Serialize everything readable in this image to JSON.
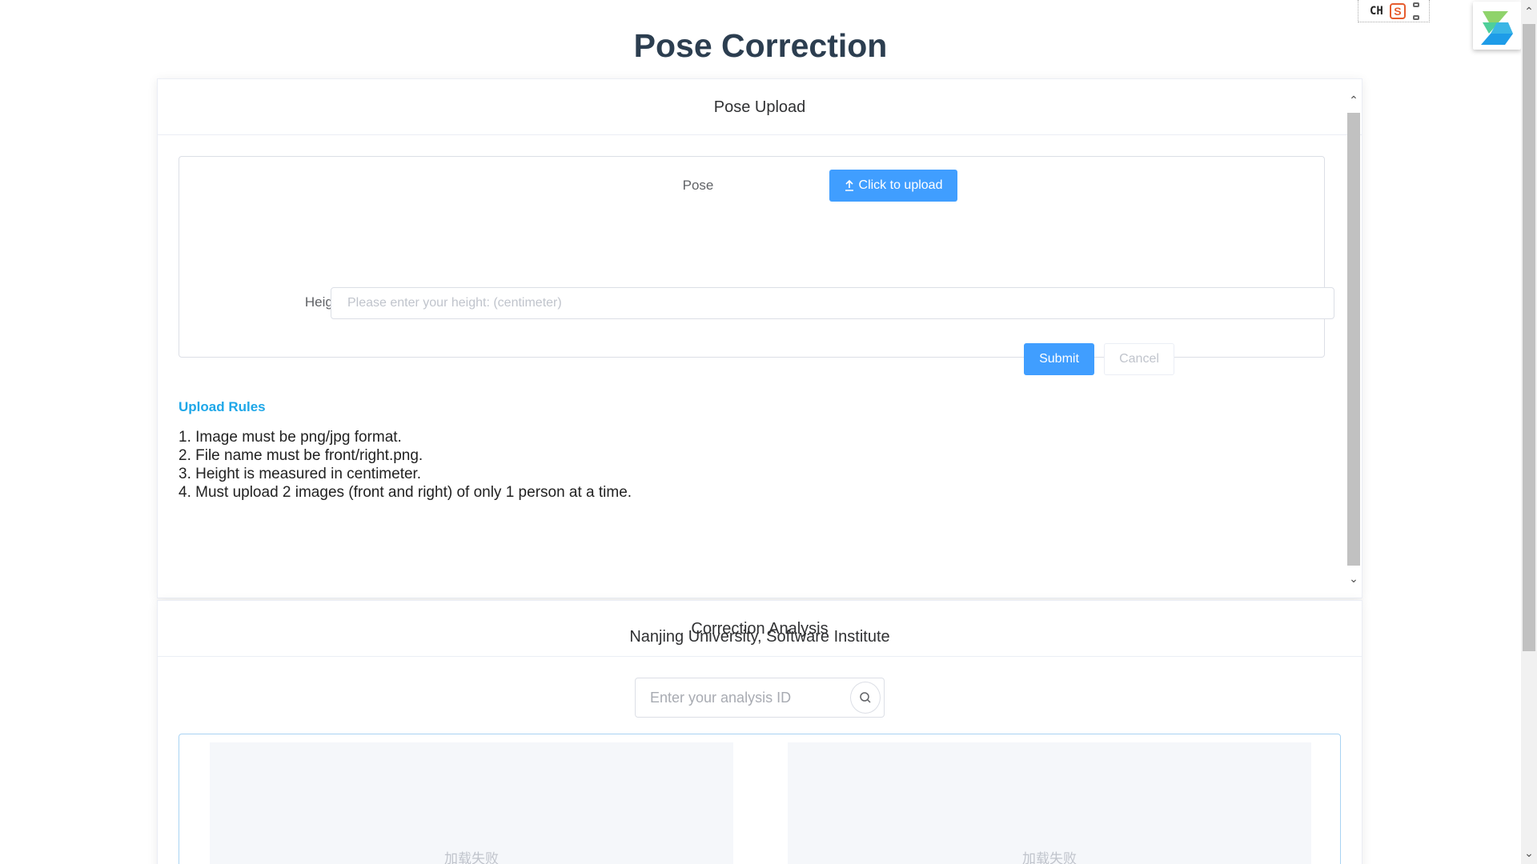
{
  "page": {
    "title": "Pose Correction"
  },
  "ime": {
    "lang": "CH",
    "logo": "S"
  },
  "upload": {
    "header": "Pose Upload",
    "pose_label": "Pose",
    "upload_button": "Click to upload",
    "height_label": "Height",
    "height_placeholder": "Please enter your height: (centimeter)",
    "submit_label": "Submit",
    "cancel_label": "Cancel",
    "rules_title": "Upload Rules",
    "rules": [
      "1. Image must be png/jpg format.",
      "2. File name must be front/right.png.",
      "3. Height is measured in centimeter.",
      "4. Must upload 2 images (front and right) of only 1 person at a time."
    ]
  },
  "analysis": {
    "header": "Correction Analysis",
    "footer": "Nanjing University, Software Institute",
    "search_placeholder": "Enter your analysis ID",
    "images": [
      {
        "status": "加载失败"
      },
      {
        "status": "加载失败"
      }
    ]
  },
  "colors": {
    "primary": "#409eff",
    "rules_title": "#1ea7e8",
    "title": "#2c3e50"
  }
}
